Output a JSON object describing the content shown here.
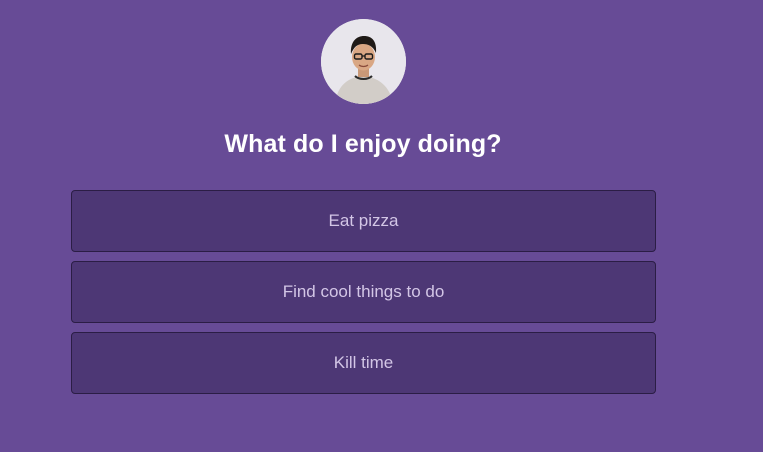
{
  "quiz": {
    "question": "What do I enjoy doing?",
    "options": [
      {
        "label": "Eat pizza"
      },
      {
        "label": "Find cool things to do"
      },
      {
        "label": "Kill time"
      }
    ]
  },
  "colors": {
    "background": "#674b96",
    "option_background": "#4d3775",
    "option_border": "#2b1d45",
    "option_text": "#d3c6e6",
    "question_text": "#ffffff"
  },
  "icons": {
    "avatar": "profile-photo"
  }
}
